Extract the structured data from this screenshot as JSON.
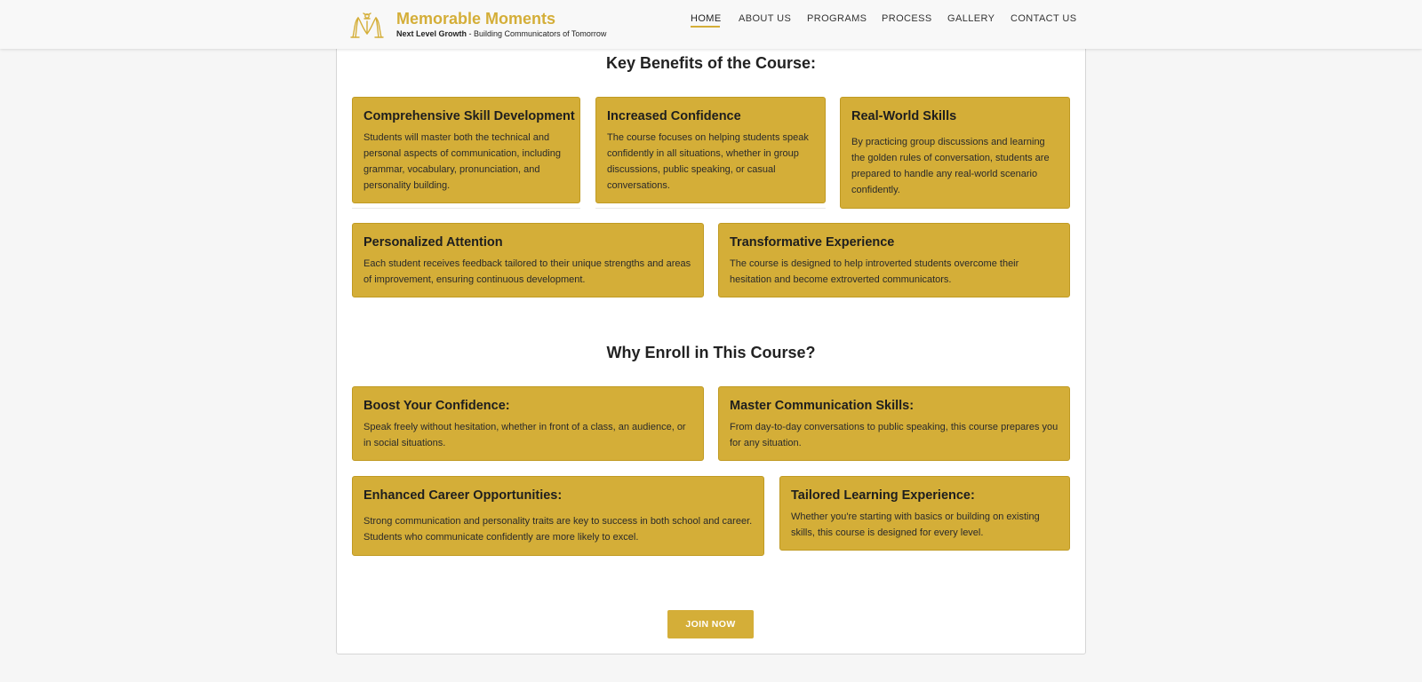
{
  "header": {
    "brand_name": "Memorable Moments",
    "tagline_bold": "Next Level Growth",
    "tagline_rest": " - Building Communicators of Tomorrow",
    "nav": [
      {
        "label": "HOME",
        "active": true
      },
      {
        "label": "ABOUT US"
      },
      {
        "label": "PROGRAMS"
      },
      {
        "label": "PROCESS"
      },
      {
        "label": "GALLERY"
      },
      {
        "label": "CONTACT US"
      }
    ]
  },
  "benefits": {
    "title": "Key Benefits of the Course:",
    "items": [
      {
        "title": "Comprehensive Skill Development",
        "text": "Students will master both the technical and personal aspects of communication, including grammar, vocabulary, pronunciation, and personality building."
      },
      {
        "title": "Increased Confidence",
        "text": "The course focuses on helping students speak confidently in all situations, whether in group discussions, public speaking, or casual conversations."
      },
      {
        "title": "Real-World Skills",
        "text": "By practicing group discussions and learning the golden rules of conversation, students are prepared to handle any real-world scenario confidently."
      },
      {
        "title": "Personalized Attention",
        "text": "Each student receives feedback tailored to their unique strengths and areas of improvement, ensuring continuous development."
      },
      {
        "title": "Transformative Experience",
        "text": "The course is designed to help introverted students overcome their hesitation and become extroverted communicators."
      }
    ]
  },
  "enroll": {
    "title": "Why Enroll in This Course?",
    "items": [
      {
        "title": "Boost Your Confidence:",
        "text": "Speak freely without hesitation, whether in front of a class, an audience, or in social situations."
      },
      {
        "title": "Master Communication Skills:",
        "text": "From day-to-day conversations to public speaking, this course prepares you for any situation."
      },
      {
        "title": "Enhanced Career Opportunities:",
        "text": "Strong communication and personality traits are key to success in both school and career. Students who communicate confidently are more likely to excel."
      },
      {
        "title": "Tailored Learning Experience:",
        "text": "Whether you're starting with basics or building on existing skills, this course is designed for every level."
      }
    ]
  },
  "cta": {
    "label": "JOIN NOW"
  },
  "colors": {
    "accent": "#d4ae38",
    "text": "#222222",
    "background": "#f6f6f6"
  }
}
